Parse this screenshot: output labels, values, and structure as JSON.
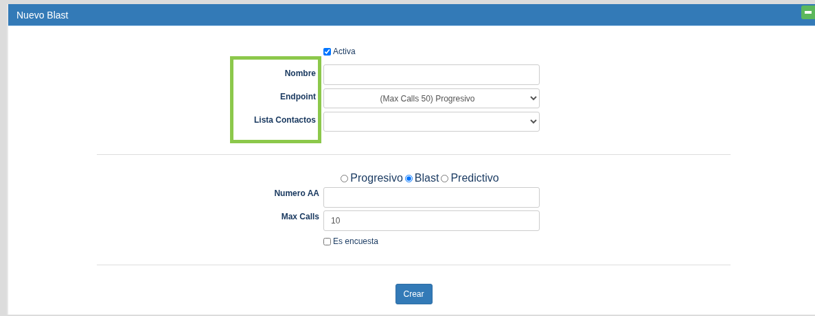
{
  "panel": {
    "title": "Nuevo Blast"
  },
  "activa": {
    "label": "Activa",
    "checked": true
  },
  "fields_top": [
    {
      "label": "Nombre",
      "kind": "text"
    },
    {
      "label": "Endpoint",
      "kind": "select",
      "value": "(Max Calls 50) Progresivo"
    },
    {
      "label": "Lista Contactos",
      "kind": "select"
    }
  ],
  "modes": [
    {
      "label": "Progresivo",
      "selected": false
    },
    {
      "label": "Blast",
      "selected": true
    },
    {
      "label": "Predictivo",
      "selected": false
    }
  ],
  "fields_bottom": [
    {
      "label": "Numero AA",
      "kind": "text"
    },
    {
      "label": "Max Calls",
      "kind": "text",
      "value": "10"
    }
  ],
  "encuesta": {
    "label": "Es encuesta",
    "checked": false
  },
  "submit": "Crear"
}
